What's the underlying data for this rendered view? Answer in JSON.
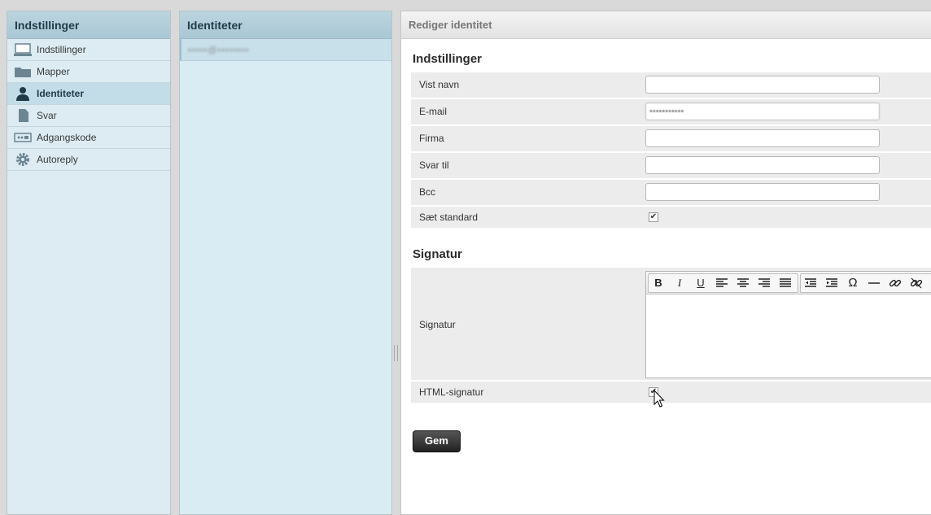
{
  "nav": {
    "title": "Indstillinger",
    "items": [
      {
        "label": "Indstillinger",
        "icon": "monitor-icon"
      },
      {
        "label": "Mapper",
        "icon": "folder-icon"
      },
      {
        "label": "Identiteter",
        "icon": "person-icon",
        "selected": true
      },
      {
        "label": "Svar",
        "icon": "document-icon"
      },
      {
        "label": "Adgangskode",
        "icon": "password-icon"
      },
      {
        "label": "Autoreply",
        "icon": "gear-icon"
      }
    ]
  },
  "identities": {
    "title": "Identiteter",
    "items": [
      {
        "label": "•••••@••••••••"
      }
    ]
  },
  "edit": {
    "title": "Rediger identitet",
    "settings_title": "Indstillinger",
    "fields": {
      "display_name": {
        "label": "Vist navn",
        "value": ""
      },
      "email": {
        "label": "E-mail",
        "value": "•••••••••••"
      },
      "company": {
        "label": "Firma",
        "value": ""
      },
      "reply_to": {
        "label": "Svar til",
        "value": ""
      },
      "bcc": {
        "label": "Bcc",
        "value": ""
      },
      "set_default": {
        "label": "Sæt standard",
        "checked": true
      }
    },
    "signature_title": "Signatur",
    "signature": {
      "label": "Signatur",
      "value": ""
    },
    "html_signature": {
      "label": "HTML-signatur",
      "checked": true
    },
    "toolbar": [
      {
        "glyph": "B",
        "icon": "bold-icon"
      },
      {
        "glyph": "I",
        "icon": "italic-icon"
      },
      {
        "glyph": "U",
        "icon": "underline-icon"
      },
      {
        "icon": "align-left-icon"
      },
      {
        "icon": "align-center-icon"
      },
      {
        "icon": "align-right-icon"
      },
      {
        "icon": "align-justify-icon"
      },
      {
        "icon": "outdent-icon"
      },
      {
        "icon": "indent-icon"
      },
      {
        "glyph": "Ω",
        "icon": "special-char-icon"
      },
      {
        "icon": "horizontal-rule-icon"
      },
      {
        "icon": "link-icon"
      },
      {
        "icon": "unlink-icon"
      }
    ],
    "save_label": "Gem"
  },
  "colors": {
    "nav_bg": "#dcecf2",
    "selected_bg": "#c3dde8",
    "header": "#a9c7d4",
    "button": "#333333"
  }
}
